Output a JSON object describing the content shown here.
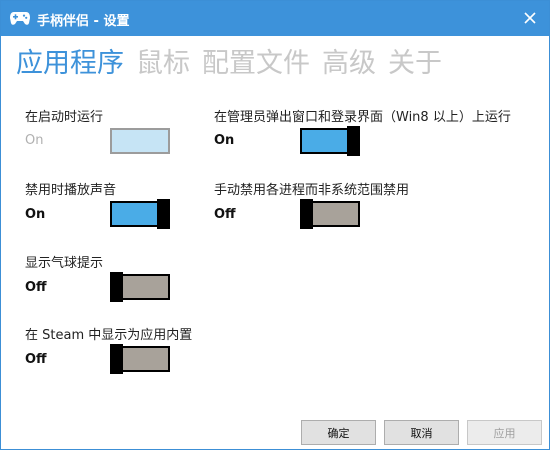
{
  "window": {
    "title": "手柄伴侣 - 设置"
  },
  "tabs": [
    {
      "label": "应用程序",
      "active": true
    },
    {
      "label": "鼠标",
      "active": false
    },
    {
      "label": "配置文件",
      "active": false
    },
    {
      "label": "高级",
      "active": false
    },
    {
      "label": "关于",
      "active": false
    }
  ],
  "settings": {
    "run_at_startup": {
      "label": "在启动时运行",
      "state": "On",
      "enabled": false
    },
    "run_above_admin": {
      "label": "在管理员弹出窗口和登录界面（Win8 以上）上运行",
      "state": "On",
      "enabled": true
    },
    "sound_on_disable": {
      "label": "禁用时播放声音",
      "state": "On",
      "enabled": true
    },
    "manual_disable_per_process": {
      "label": "手动禁用各进程而非系统范围禁用",
      "state": "Off",
      "enabled": true
    },
    "show_balloon_tips": {
      "label": "显示气球提示",
      "state": "Off",
      "enabled": true
    },
    "steam_builtin": {
      "label": "在 Steam 中显示为应用内置",
      "state": "Off",
      "enabled": true
    }
  },
  "buttons": {
    "ok": "确定",
    "cancel": "取消",
    "apply": "应用"
  },
  "colors": {
    "accent": "#3d92da",
    "toggle_on": "#4aace7",
    "toggle_off": "#a8a29a",
    "inactive_tab": "#c8c8c8"
  }
}
